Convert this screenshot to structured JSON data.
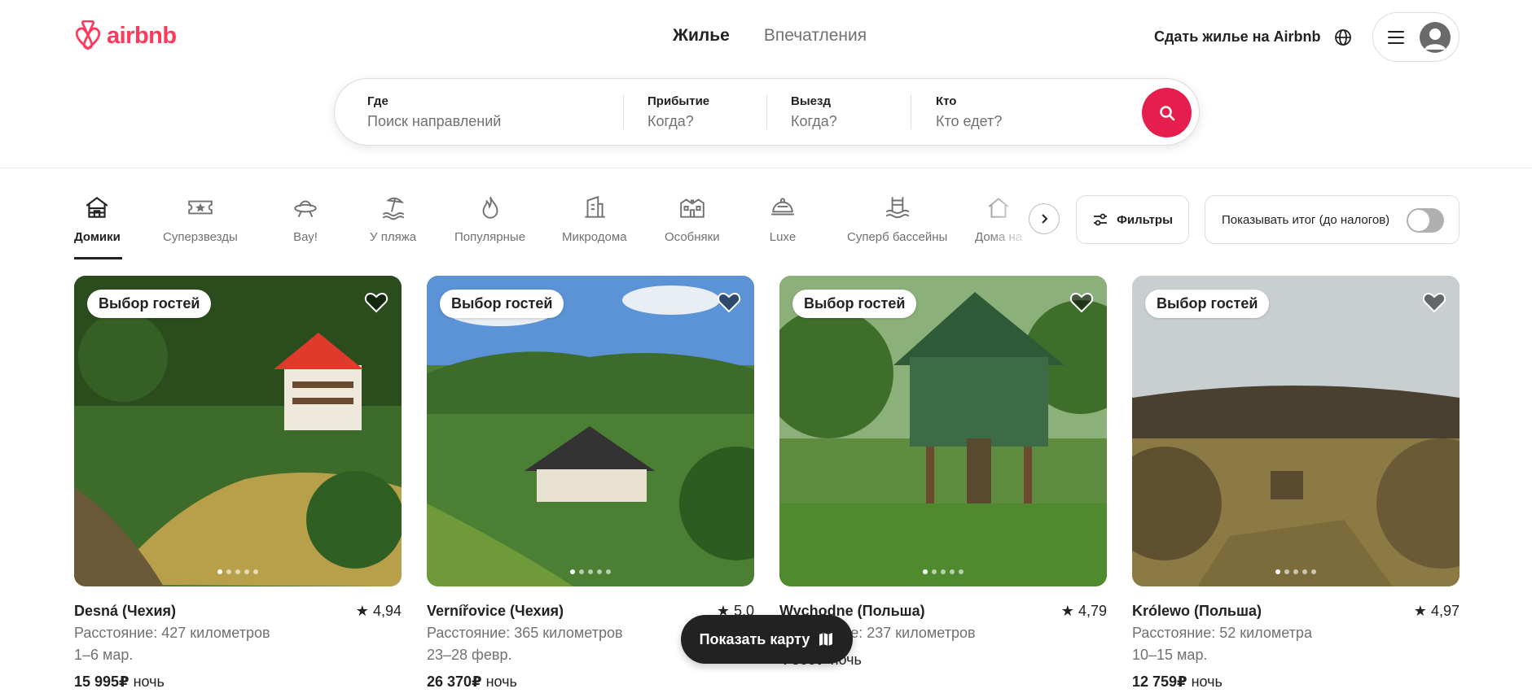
{
  "colors": {
    "brand": "#ff385c",
    "search_button": "#e61e4d",
    "text": "#222222",
    "muted": "#717171"
  },
  "header": {
    "logo_text": "airbnb",
    "tabs": [
      {
        "label": "Жилье",
        "active": true
      },
      {
        "label": "Впечатления",
        "active": false
      }
    ],
    "host_link": "Сдать жилье на Airbnb",
    "globe_icon": "globe-icon",
    "menu_icon": "hamburger-icon",
    "avatar_icon": "user-avatar-icon"
  },
  "search": {
    "where": {
      "label": "Где",
      "placeholder": "Поиск направлений"
    },
    "checkin": {
      "label": "Прибытие",
      "placeholder": "Когда?"
    },
    "checkout": {
      "label": "Выезд",
      "placeholder": "Когда?"
    },
    "who": {
      "label": "Кто",
      "placeholder": "Кто едет?"
    },
    "button_icon": "search-icon"
  },
  "categories": [
    {
      "label": "Домики",
      "icon": "cabin-icon",
      "active": true
    },
    {
      "label": "Суперзвезды",
      "icon": "ticket-star-icon"
    },
    {
      "label": "Вау!",
      "icon": "ufo-icon"
    },
    {
      "label": "У пляжа",
      "icon": "beach-icon"
    },
    {
      "label": "Популярные",
      "icon": "flame-icon"
    },
    {
      "label": "Микродома",
      "icon": "tiny-house-icon"
    },
    {
      "label": "Особняки",
      "icon": "mansion-icon"
    },
    {
      "label": "Luxe",
      "icon": "luxe-bell-icon"
    },
    {
      "label": "Суперб бассейны",
      "icon": "pool-icon"
    },
    {
      "label": "Дома на",
      "icon": "house-icon"
    }
  ],
  "filters": {
    "button_label": "Фильтры",
    "taxes_label": "Показывать итог (до налогов)",
    "taxes_on": false
  },
  "listings": [
    {
      "badge": "Выбор гостей",
      "title": "Desná (Чехия)",
      "rating": "4,94",
      "distance": "Расстояние: 427 километров",
      "dates": "1–6 мар.",
      "price": "15 995₽",
      "price_unit": "ночь"
    },
    {
      "badge": "Выбор гостей",
      "title": "Vernířovice (Чехия)",
      "rating": "5,0",
      "distance": "Расстояние: 365 километров",
      "dates": "23–28 февр.",
      "price": "26 370₽",
      "price_unit": "ночь"
    },
    {
      "badge": "Выбор гостей",
      "title": "Wychodne (Польша)",
      "rating": "4,79",
      "distance": "Расстояние: 237 километров",
      "dates": "",
      "price": "4 309₽",
      "price_unit": "ночь"
    },
    {
      "badge": "Выбор гостей",
      "title": "Królewo (Польша)",
      "rating": "4,97",
      "distance": "Расстояние: 52 километра",
      "dates": "10–15 мар.",
      "price": "12 759₽",
      "price_unit": "ночь"
    }
  ],
  "map_button": {
    "label": "Показать карту",
    "icon": "map-icon"
  }
}
